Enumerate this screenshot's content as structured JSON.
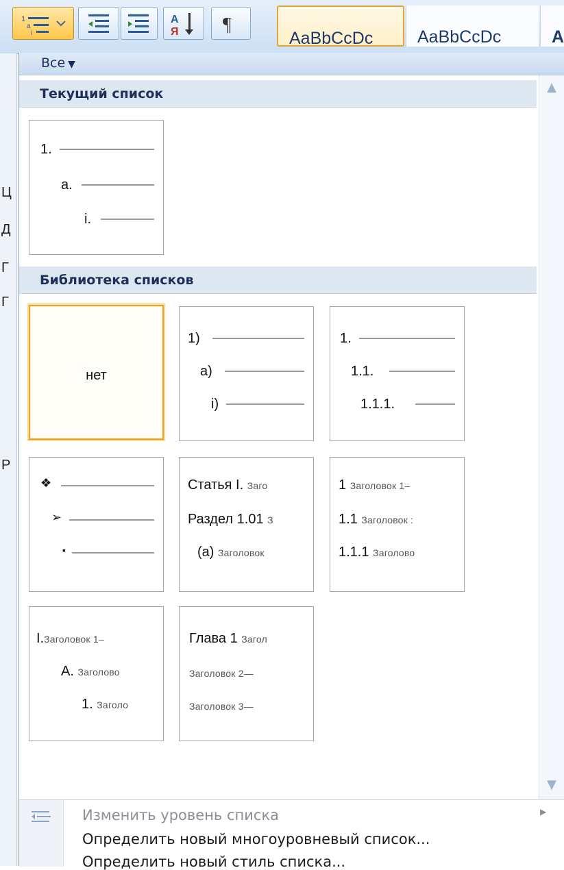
{
  "ribbon": {
    "style_previews": [
      "AaBbCcDc",
      "AaBbCcDc",
      "A"
    ]
  },
  "doc_strip": {
    "glyphs": [
      "Ц",
      "Д",
      "Г",
      "Г",
      "Р"
    ]
  },
  "menu": {
    "filter": {
      "label": "Все",
      "arrow": "▼"
    },
    "current_section": {
      "title": "Текущий список",
      "tile": {
        "levels": [
          "1.",
          "a.",
          "i."
        ]
      }
    },
    "library_section": {
      "title": "Библиотека списков",
      "tiles": [
        {
          "kind": "none",
          "text": "нет"
        },
        {
          "kind": "levels",
          "levels": [
            "1)",
            "a)",
            "i)"
          ]
        },
        {
          "kind": "levels",
          "levels": [
            "1.",
            "1.1.",
            "1.1.1."
          ]
        },
        {
          "kind": "bullets",
          "levels": [
            "❖",
            "➢",
            "▪"
          ]
        },
        {
          "kind": "headings",
          "rows": [
            {
              "num": "Статья I.",
              "rest": "Заго"
            },
            {
              "num": "Раздел 1.01",
              "rest": "З"
            },
            {
              "num": "(a)",
              "rest": "Заголовок"
            }
          ]
        },
        {
          "kind": "headings",
          "rows": [
            {
              "num": "1",
              "rest": "Заголовок 1–"
            },
            {
              "num": "1.1",
              "rest": "Заголовок :"
            },
            {
              "num": "1.1.1",
              "rest": "Заголово"
            }
          ]
        },
        {
          "kind": "headings",
          "rows": [
            {
              "num": "I.",
              "rest": "Заголовок 1–"
            },
            {
              "num": "A.",
              "rest": "Заголово"
            },
            {
              "num": "1.",
              "rest": "Заголо"
            }
          ]
        },
        {
          "kind": "headings",
          "rows": [
            {
              "num": "Глава 1",
              "rest": "Загол"
            },
            {
              "num": "",
              "rest": "Заголовок 2—"
            },
            {
              "num": "",
              "rest": "Заголовок 3—"
            }
          ]
        }
      ]
    },
    "commands": [
      {
        "label": "Изменить уровень списка",
        "disabled": true,
        "icon": "change-level-icon"
      },
      {
        "label": "Определить новый многоуровневый список...",
        "disabled": false
      },
      {
        "label": "Определить новый стиль списка...",
        "disabled": false
      }
    ]
  },
  "colors": {
    "accent_selected": "#e6a537",
    "section_header": "#dde7f2",
    "text_heading": "#1e3056"
  }
}
